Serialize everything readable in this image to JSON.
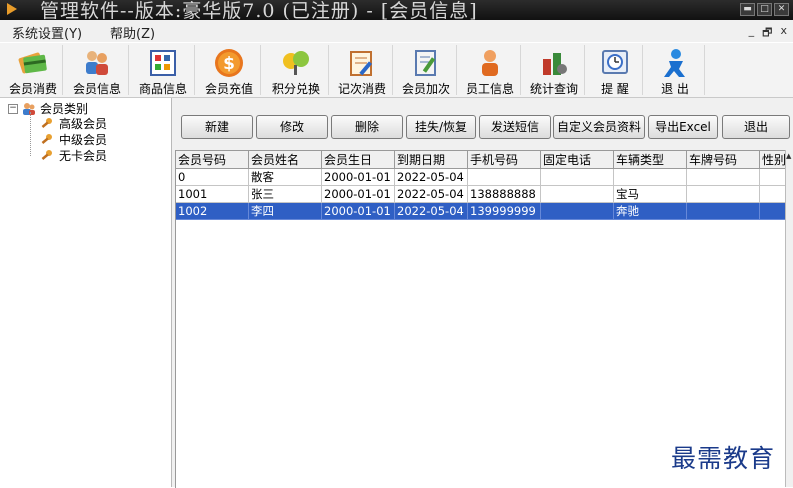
{
  "window": {
    "title": "管理软件--版本:豪华版7.0 (已注册) - [会员信息]",
    "controls": [
      "▬",
      "□",
      "✕"
    ]
  },
  "menu": {
    "items": [
      "系统设置(Y)",
      "帮助(Z)"
    ],
    "mdi_controls": [
      "_",
      "🗗",
      "x"
    ]
  },
  "toolbar": {
    "items": [
      {
        "label": "会员消费",
        "icon": "card-icon"
      },
      {
        "label": "会员信息",
        "icon": "users-icon"
      },
      {
        "label": "商品信息",
        "icon": "grid-icon"
      },
      {
        "label": "会员充值",
        "icon": "dollar-icon"
      },
      {
        "label": "积分兑换",
        "icon": "exchange-icon"
      },
      {
        "label": "记次消费",
        "icon": "notepad-icon"
      },
      {
        "label": "会员加次",
        "icon": "edit-icon"
      },
      {
        "label": "员工信息",
        "icon": "person-icon"
      },
      {
        "label": "统计查询",
        "icon": "chart-icon"
      },
      {
        "label": "提 醒",
        "icon": "clock-icon"
      },
      {
        "label": "退 出",
        "icon": "exit-person-icon"
      }
    ]
  },
  "tree": {
    "expander": "−",
    "root": "会员类别",
    "children": [
      "高级会员",
      "中级会员",
      "无卡会员"
    ]
  },
  "actions": {
    "new": "新建",
    "edit": "修改",
    "delete": "删除",
    "lost": "挂失/恢复",
    "sms": "发送短信",
    "custom": "自定义会员资料",
    "export": "导出Excel",
    "exit": "退出"
  },
  "table": {
    "columns": [
      "会员号码",
      "会员姓名",
      "会员生日",
      "到期日期",
      "手机号码",
      "固定电话",
      "车辆类型",
      "车牌号码",
      "性别"
    ],
    "rows": [
      [
        "0",
        "散客",
        "2000-01-01",
        "2022-05-04",
        "",
        "",
        "",
        "",
        ""
      ],
      [
        "1001",
        "张三",
        "2000-01-01",
        "2022-05-04",
        "138888888",
        "",
        "宝马",
        "",
        ""
      ],
      [
        "1002",
        "李四",
        "2000-01-01",
        "2022-05-04",
        "139999999",
        "",
        "奔驰",
        "",
        ""
      ]
    ],
    "selected_row": 2
  },
  "scrollbar": {
    "arrow": "▲"
  },
  "watermark": "最需教育"
}
